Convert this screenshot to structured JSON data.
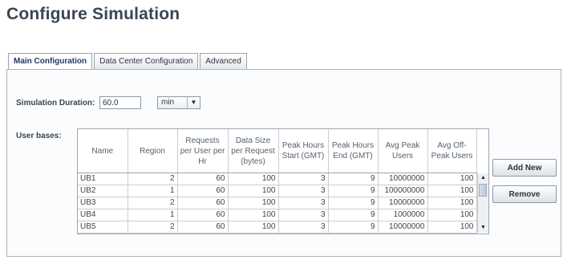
{
  "page": {
    "title": "Configure Simulation"
  },
  "tabs": [
    {
      "label": "Main Configuration",
      "active": true
    },
    {
      "label": "Data Center Configuration",
      "active": false
    },
    {
      "label": "Advanced",
      "active": false
    }
  ],
  "duration": {
    "label": "Simulation Duration:",
    "value": "60.0",
    "unit": "min"
  },
  "user_bases": {
    "label": "User bases:",
    "columns": [
      "Name",
      "Region",
      "Requests per User per Hr",
      "Data Size per Request (bytes)",
      "Peak Hours Start (GMT)",
      "Peak Hours End (GMT)",
      "Avg Peak Users",
      "Avg Off-Peak Users"
    ],
    "rows": [
      [
        "UB1",
        "2",
        "60",
        "100",
        "3",
        "9",
        "10000000",
        "100"
      ],
      [
        "UB2",
        "1",
        "60",
        "100",
        "3",
        "9",
        "100000000",
        "100"
      ],
      [
        "UB3",
        "2",
        "60",
        "100",
        "3",
        "9",
        "10000000",
        "100"
      ],
      [
        "UB4",
        "1",
        "60",
        "100",
        "3",
        "9",
        "1000000",
        "100"
      ],
      [
        "UB5",
        "2",
        "60",
        "100",
        "3",
        "9",
        "10000000",
        "100"
      ]
    ]
  },
  "buttons": {
    "add_new": "Add New",
    "remove": "Remove"
  },
  "icons": {
    "scroll_up": "arrow-up-icon",
    "scroll_down": "arrow-down-icon",
    "dropdown": "chevron-down-icon"
  }
}
